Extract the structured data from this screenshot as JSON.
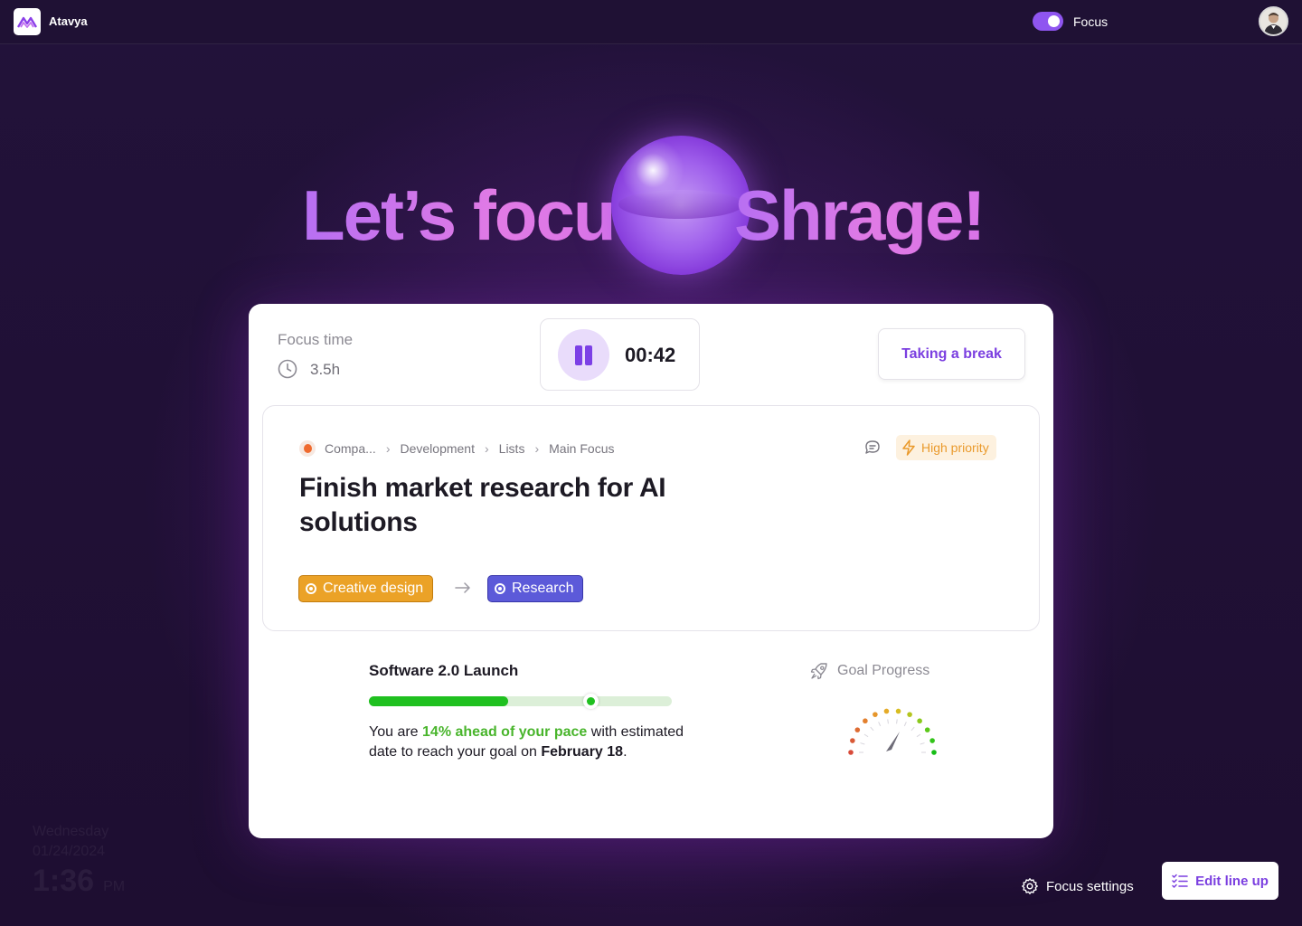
{
  "app": {
    "name": "Atavya"
  },
  "header": {
    "focus_toggle_label": "Focus",
    "focus_on": true
  },
  "hero": {
    "greeting": "Let’s focus",
    "name": "Shrage!"
  },
  "focus_time": {
    "label": "Focus time",
    "value": "3.5h"
  },
  "timer": {
    "value": "00:42"
  },
  "break_button": {
    "label": "Taking a break"
  },
  "task": {
    "breadcrumbs": [
      "Compa...",
      "Development",
      "Lists",
      "Main Focus"
    ],
    "priority": "High priority",
    "title": "Finish market research for AI solutions",
    "tags": [
      "Creative design",
      "Research"
    ]
  },
  "goal": {
    "name": "Software 2.0 Launch",
    "progress": 0.46,
    "pace_marker": 0.73,
    "text_before": "You are ",
    "highlight": "14% ahead of your pace",
    "text_middle": " with estimated date to reach your goal on ",
    "date": "February 18",
    "text_end": ".",
    "gauge_label": "Goal Progress"
  },
  "clock": {
    "day": "Wednesday",
    "date": "01/24/2024",
    "time": "1:36",
    "ampm": "PM"
  },
  "footer": {
    "settings_label": "Focus settings",
    "edit_label": "Edit line up"
  },
  "colors": {
    "accent": "#7b3fe0",
    "progress": "#1fc01f",
    "priority": "#ea9a2c",
    "tag_creative": "#eba227",
    "tag_research": "#5c5ad9"
  }
}
